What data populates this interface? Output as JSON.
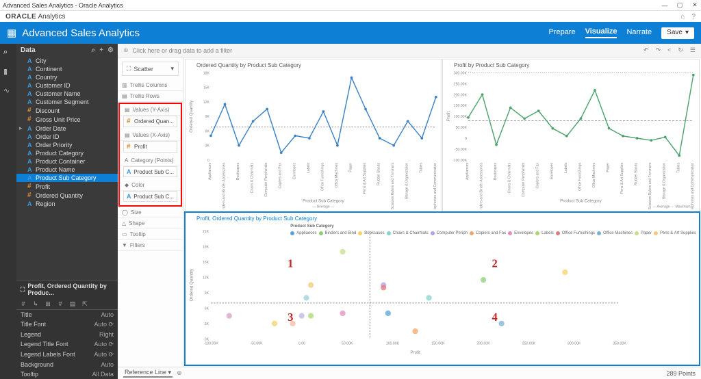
{
  "window": {
    "title": "Advanced Sales Analytics - Oracle Analytics"
  },
  "brand": {
    "name": "ORACLE",
    "product": "Analytics",
    "home_icon": "home-icon",
    "help_icon": "help-icon"
  },
  "header": {
    "title": "Advanced Sales Analytics",
    "tabs": {
      "prepare": "Prepare",
      "visualize": "Visualize",
      "narrate": "Narrate"
    },
    "save": "Save"
  },
  "data_panel": {
    "title": "Data",
    "items": [
      {
        "label": "City",
        "type": "attr"
      },
      {
        "label": "Continent",
        "type": "attr"
      },
      {
        "label": "Country",
        "type": "attr"
      },
      {
        "label": "Customer ID",
        "type": "attr"
      },
      {
        "label": "Customer Name",
        "type": "attr"
      },
      {
        "label": "Customer Segment",
        "type": "attr"
      },
      {
        "label": "Discount",
        "type": "meas"
      },
      {
        "label": "Gross Unit Price",
        "type": "meas"
      },
      {
        "label": "Order Date",
        "type": "attr",
        "expandable": true
      },
      {
        "label": "Order ID",
        "type": "attr"
      },
      {
        "label": "Order Priority",
        "type": "attr"
      },
      {
        "label": "Product Category",
        "type": "attr"
      },
      {
        "label": "Product Container",
        "type": "attr"
      },
      {
        "label": "Product Name",
        "type": "attr"
      },
      {
        "label": "Product Sub Category",
        "type": "attr",
        "selected": true
      },
      {
        "label": "Profit",
        "type": "meas"
      },
      {
        "label": "Ordered Quantity",
        "type": "meas"
      },
      {
        "label": "Region",
        "type": "attr"
      }
    ]
  },
  "properties": {
    "title": "Profit, Ordered Quantity by Produc...",
    "rows": [
      {
        "label": "Title",
        "value": "Auto"
      },
      {
        "label": "Title Font",
        "value": "Auto",
        "refresh": true
      },
      {
        "label": "Legend",
        "value": "Right"
      },
      {
        "label": "Legend Title Font",
        "value": "Auto",
        "refresh": true
      },
      {
        "label": "Legend Labels Font",
        "value": "Auto",
        "refresh": true
      },
      {
        "label": "Background",
        "value": "Auto"
      },
      {
        "label": "Tooltip",
        "value": "All Data"
      }
    ]
  },
  "filterbar": {
    "hint": "Click here or drag data to add a filter"
  },
  "grammar": {
    "viztype": "Scatter",
    "trellis_col": "Trellis Columns",
    "trellis_row": "Trellis Rows",
    "values_y": "Values (Y-Axis)",
    "values_y_val": "Ordered Quan...",
    "values_x": "Values (X-Axis)",
    "values_x_val": "Profit",
    "category": "Category (Points)",
    "category_val": "Product Sub C...",
    "color": "Color",
    "color_val": "Product Sub C...",
    "size": "Size",
    "shape": "Shape",
    "tooltip": "Tooltip",
    "filters": "Filters"
  },
  "chart_data": [
    {
      "type": "line",
      "title": "Ordered Quantity by Product Sub Category",
      "ylabel": "Ordered Quantity",
      "xlabel": "Product Sub Category",
      "ylim": [
        0,
        18000
      ],
      "yticks": [
        0,
        3000,
        6000,
        9000,
        12000,
        15000,
        18000
      ],
      "ytick_labels": [
        "0",
        "3K",
        "6K",
        "9K",
        "12K",
        "15K",
        "18K"
      ],
      "categories": [
        "Appliances",
        "Binders and Binder Accessories",
        "Bookcases",
        "Chairs & Chairmats",
        "Computer Peripherals",
        "Copiers and Fax",
        "Envelopes",
        "Labels",
        "Office Furnishings",
        "Office Machines",
        "Paper",
        "Pens & Art Supplies",
        "Rubber Bands",
        "Scissors Rulers and Trimmers",
        "Storage & Organization",
        "Tables",
        "Telephones and Communication"
      ],
      "values": [
        5000,
        11500,
        3000,
        8000,
        10500,
        1500,
        5000,
        4500,
        10000,
        3000,
        17000,
        10500,
        4500,
        3000,
        8000,
        4500,
        13000
      ],
      "reference_line": 6800,
      "reference_label": "Average"
    },
    {
      "type": "line",
      "title": "Profit by Product Sub Category",
      "ylabel": "Profit",
      "xlabel": "Product Sub Category",
      "ylim": [
        -100000,
        300000
      ],
      "yticks": [
        -100000,
        -50000,
        0,
        50000,
        100000,
        150000,
        200000,
        250000,
        300000
      ],
      "ytick_labels": [
        "-100.00K",
        "-50.00K",
        "0",
        "50.00K",
        "100.00K",
        "150.00K",
        "200.00K",
        "250.00K",
        "300.00K"
      ],
      "categories": [
        "Appliances",
        "Binders and Binder Accessories",
        "Bookcases",
        "Chairs & Chairmats",
        "Computer Peripherals",
        "Copiers and Fax",
        "Envelopes",
        "Labels",
        "Office Furnishings",
        "Office Machines",
        "Paper",
        "Pens & Art Supplies",
        "Rubber Bands",
        "Scissors Rulers and Trimmers",
        "Storage & Organization",
        "Tables",
        "Telephones and Communication"
      ],
      "values": [
        95000,
        200000,
        -30000,
        140000,
        90000,
        125000,
        45000,
        10000,
        90000,
        220000,
        45000,
        10000,
        -100,
        -10000,
        5000,
        -80000,
        290000
      ],
      "reference_lines": {
        "average": 80000,
        "maximum": 300000
      },
      "reference_labels": [
        "Average",
        "Maximum"
      ]
    },
    {
      "type": "scatter",
      "title": "Profit, Ordered Quantity by Product Sub Category",
      "xlabel": "Profit",
      "ylabel": "Ordered Quantity",
      "xlim": [
        -100000,
        350000
      ],
      "ylim": [
        0,
        21000
      ],
      "xticks": [
        -100000,
        -50000,
        0,
        50000,
        100000,
        150000,
        200000,
        250000,
        300000,
        350000
      ],
      "xtick_labels": [
        "-100.00K",
        "-50.00K",
        "0.00",
        "50.00K",
        "100.00K",
        "150.00K",
        "200.00K",
        "250.00K",
        "300.00K",
        "350.00K"
      ],
      "yticks": [
        0,
        3000,
        6000,
        9000,
        12000,
        15000,
        18000,
        21000
      ],
      "ytick_labels": [
        "0K",
        "3K",
        "6K",
        "9K",
        "12K",
        "15K",
        "18K",
        "21K"
      ],
      "legend_title": "Product Sub Category",
      "legend_items": [
        "Appliances",
        "Binders and Bind",
        "Bookcases",
        "Chairs & Chairmats",
        "Computer Periph",
        "Copiers and Fax",
        "Envelopes",
        "Labels",
        "Office Furnishings",
        "Office Machines",
        "Paper",
        "Pens & Art Supplies"
      ],
      "legend_colors": [
        "#5aa3d8",
        "#8fcf74",
        "#f3d36a",
        "#85d4c9",
        "#b9a0e0",
        "#f2a56a",
        "#e48fbc",
        "#a7d96f",
        "#e07c7c",
        "#7db1d4",
        "#c6e08a",
        "#f0c97a"
      ],
      "reference_x": 75000,
      "reference_y": 7000,
      "quadrant_labels": [
        "1",
        "2",
        "3",
        "4"
      ],
      "points": [
        {
          "name": "Appliances",
          "x": 95000,
          "y": 5000,
          "color": "#5aa3d8"
        },
        {
          "name": "Binders and Binder Accessories",
          "x": 200000,
          "y": 11500,
          "color": "#8fcf74"
        },
        {
          "name": "Bookcases",
          "x": -30000,
          "y": 3000,
          "color": "#f3d36a"
        },
        {
          "name": "Chairs & Chairmats",
          "x": 140000,
          "y": 8000,
          "color": "#85d4c9"
        },
        {
          "name": "Computer Peripherals",
          "x": 90000,
          "y": 10500,
          "color": "#b9a0e0"
        },
        {
          "name": "Copiers and Fax",
          "x": 125000,
          "y": 1500,
          "color": "#f2a56a"
        },
        {
          "name": "Envelopes",
          "x": 45000,
          "y": 5000,
          "color": "#e48fbc"
        },
        {
          "name": "Labels",
          "x": 10000,
          "y": 4500,
          "color": "#a7d96f"
        },
        {
          "name": "Office Furnishings",
          "x": 90000,
          "y": 10000,
          "color": "#e07c7c"
        },
        {
          "name": "Office Machines",
          "x": 220000,
          "y": 3000,
          "color": "#7db1d4"
        },
        {
          "name": "Paper",
          "x": 45000,
          "y": 17000,
          "color": "#c6e08a"
        },
        {
          "name": "Pens & Art Supplies",
          "x": 10000,
          "y": 10500,
          "color": "#f0c97a"
        },
        {
          "name": "Rubber Bands",
          "x": -100,
          "y": 4500,
          "color": "#bdb5e6"
        },
        {
          "name": "Scissors Rulers and Trimmers",
          "x": -10000,
          "y": 3000,
          "color": "#f5b8a0"
        },
        {
          "name": "Storage & Organization",
          "x": 5000,
          "y": 8000,
          "color": "#9cd2d6"
        },
        {
          "name": "Tables",
          "x": -80000,
          "y": 4500,
          "color": "#d4a0c2"
        },
        {
          "name": "Telephones and Communication",
          "x": 290000,
          "y": 13000,
          "color": "#f3d36a"
        }
      ]
    }
  ],
  "footer": {
    "tab": "Reference Line",
    "points": "289 Points"
  }
}
